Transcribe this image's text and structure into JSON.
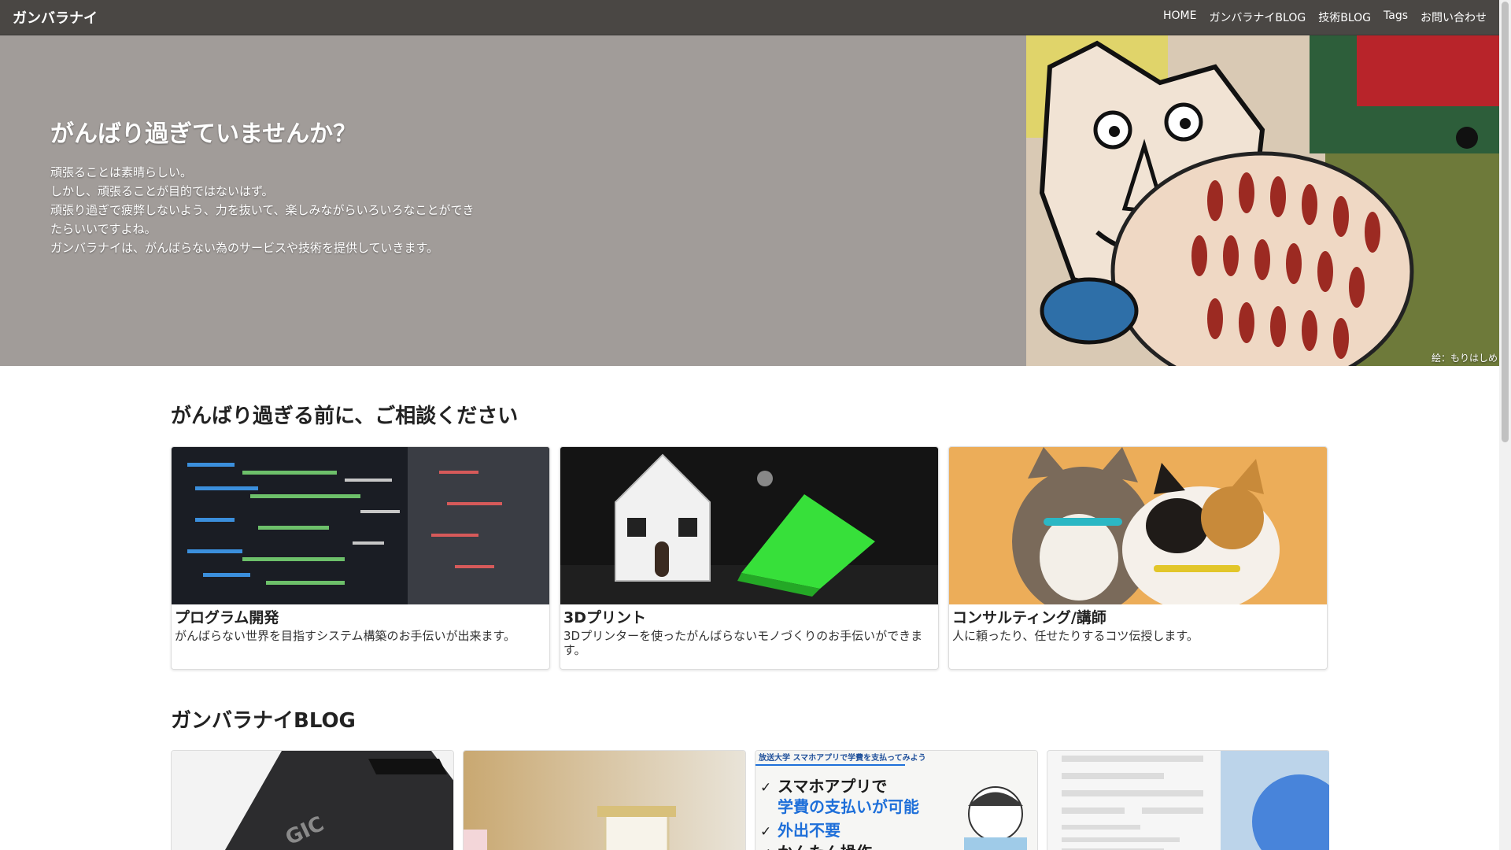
{
  "navbar": {
    "brand": "ガンバラナイ",
    "links": [
      "HOME",
      "ガンバラナイBLOG",
      "技術BLOG",
      "Tags",
      "お問い合わせ"
    ]
  },
  "hero": {
    "title": "がんばり過ぎていませんか？",
    "lines": [
      "頑張ることは素晴らしい。",
      "しかし、頑張ることが目的ではないはず。",
      "頑張り過ぎで疲弊しないよう、力を抜いて、楽しみながらいろいろなことができ",
      "たらいいですよね。",
      "ガンバラナイは、がんばらない為のサービスや技術を提供していきます。"
    ],
    "art_credit": "絵：もりはしめ"
  },
  "services": {
    "heading": "がんばり過ぎる前に、ご相談ください",
    "cards": [
      {
        "title": "プログラム開発",
        "text": "がんばらない世界を目指すシステム構築のお手伝いが出来ます。",
        "image_icon": "code-screen-photo"
      },
      {
        "title": "3Dプリント",
        "text": "3Dプリンターを使ったがんばらないモノづくりのお手伝いができます。",
        "image_icon": "3d-printed-house-photo"
      },
      {
        "title": "コンサルティング/講師",
        "text": "人に頼ったり、任せたりするコツ伝授します。",
        "image_icon": "kittens-photo"
      }
    ]
  },
  "blog": {
    "heading": "ガンバラナイBLOG",
    "cards": [
      {
        "image_icon": "device-photo",
        "caption": "GIC"
      },
      {
        "image_icon": "toilet-paper-photo"
      },
      {
        "image_icon": "smartphone-payment-banner",
        "lines": [
          "放送大学 スマホアプリで学費を支払ってみよう",
          "スマホアプリで",
          "学費の支払いが可能",
          "外出不要",
          "かんたん操作"
        ]
      },
      {
        "image_icon": "installer-screenshot"
      }
    ]
  },
  "colors": {
    "navbar": "#4a4744",
    "hero_bg": "#a19c99",
    "accent_blue": "#1e6fd9"
  }
}
